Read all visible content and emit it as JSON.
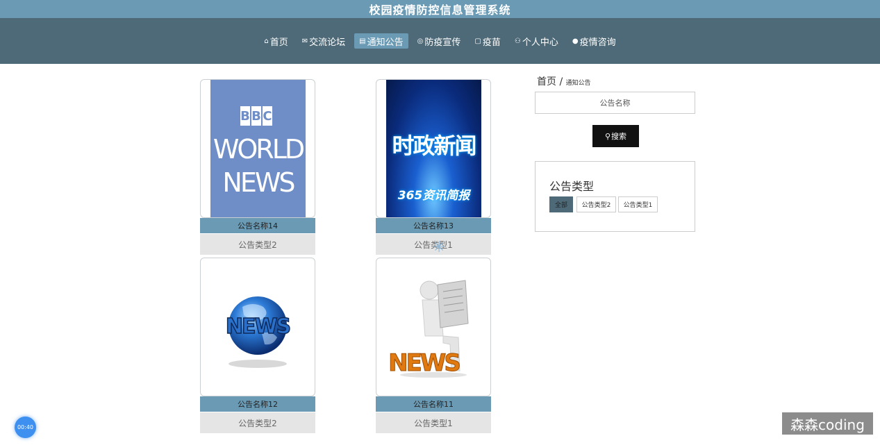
{
  "app": {
    "title": "校园疫情防控信息管理系统"
  },
  "nav": {
    "items": [
      {
        "icon": "⌂",
        "label": "首页"
      },
      {
        "icon": "✉",
        "label": "交流论坛"
      },
      {
        "icon": "▤",
        "label": "通知公告"
      },
      {
        "icon": "◎",
        "label": "防疫宣传"
      },
      {
        "icon": "▢",
        "label": "疫苗"
      },
      {
        "icon": "⚇",
        "label": "个人中心"
      },
      {
        "icon": "●",
        "label": "疫情咨询"
      }
    ],
    "active_index": 2
  },
  "cards": [
    {
      "title": "公告名称14",
      "type": "公告类型2",
      "image": "bbc-world-news-icon"
    },
    {
      "title": "公告名称13",
      "type": "公告类型1",
      "image": "current-affairs-news-icon",
      "image_text": "时政新闻",
      "image_subtext": "365资讯简报"
    },
    {
      "title": "公告名称12",
      "type": "公告类型2",
      "image": "news-globe-icon"
    },
    {
      "title": "公告名称11",
      "type": "公告类型1",
      "image": "news-reader-figure-icon"
    }
  ],
  "bbc_logo": {
    "line1": "BBC",
    "line2": "WORLD",
    "line3": "NEWS"
  },
  "breadcrumb": {
    "home": "首页",
    "separator": "/",
    "current": "通知公告"
  },
  "search": {
    "placeholder": "公告名称",
    "button_label": "搜索",
    "button_icon": "search-icon"
  },
  "type_panel": {
    "title": "公告类型",
    "options": [
      "全部",
      "公告类型2",
      "公告类型1"
    ],
    "selected_index": 0
  },
  "overlay": {
    "timer": "00:40",
    "watermark": "森森coding"
  },
  "colors": {
    "header_light": "#6a9ab4",
    "header_dark": "#4e6a78",
    "search_button": "#111111"
  }
}
